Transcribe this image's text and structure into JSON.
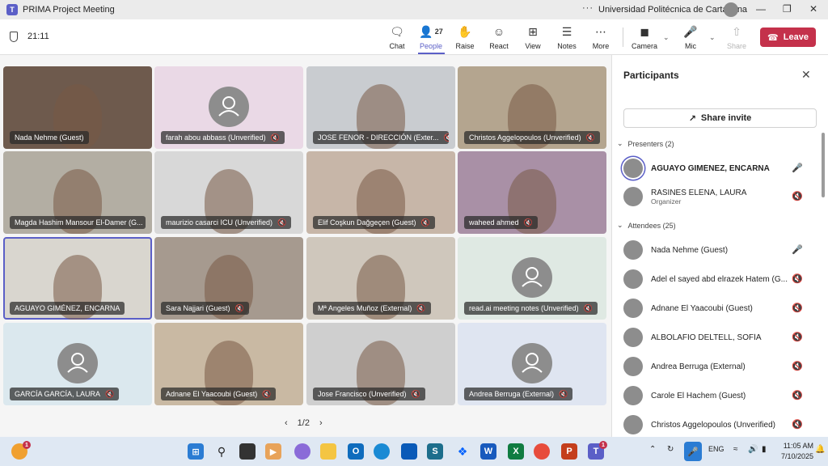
{
  "window": {
    "title": "PRIMA Project Meeting",
    "organization": "Universidad Politécnica de Cartagena",
    "more": "···"
  },
  "toolbar": {
    "timer": "21:11",
    "chat": "Chat",
    "people": "People",
    "people_count": "27",
    "raise": "Raise",
    "react": "React",
    "view": "View",
    "notes": "Notes",
    "more": "More",
    "camera": "Camera",
    "mic": "Mic",
    "share": "Share",
    "leave": "Leave"
  },
  "tiles": [
    {
      "name": "Nada Nehme (Guest)",
      "muted": false,
      "video": true,
      "bg": "#6e5a4d"
    },
    {
      "name": "farah abou abbass (Unverified)",
      "muted": true,
      "video": false,
      "bg": "#ead9e6"
    },
    {
      "name": "JOSE FENOR - DIRECCIÓN (Exter...",
      "muted": true,
      "video": true,
      "bg": "#c9ccd0"
    },
    {
      "name": "Christos Aggelopoulos (Unverified)",
      "muted": true,
      "video": true,
      "bg": "#b4a58f"
    },
    {
      "name": "Magda Hashim Mansour El-Damer (G...",
      "muted": false,
      "video": true,
      "bg": "#b3aea3"
    },
    {
      "name": "maurizio casarci ICU (Unverified)",
      "muted": true,
      "video": true,
      "bg": "#d8d8d8"
    },
    {
      "name": "Elif Coşkun Dağgeçen (Guest)",
      "muted": true,
      "video": true,
      "bg": "#c7b6a8"
    },
    {
      "name": "waheed ahmed",
      "muted": true,
      "video": true,
      "bg": "#a990a6"
    },
    {
      "name": "AGUAYO GIMÉNEZ, ENCARNA",
      "muted": false,
      "video": true,
      "bg": "#d9d6cf"
    },
    {
      "name": "Sara Najjari (Guest)",
      "muted": true,
      "video": true,
      "bg": "#a69a8f"
    },
    {
      "name": "Mª Angeles Muñoz (External)",
      "muted": true,
      "video": true,
      "bg": "#cfc7bc"
    },
    {
      "name": "read.ai meeting notes (Unverified)",
      "muted": true,
      "video": false,
      "bg": "#dfe9e3"
    },
    {
      "name": "GARCÍA GARCÍA, LAURA",
      "muted": true,
      "video": false,
      "bg": "#dbe8ee"
    },
    {
      "name": "Adnane El Yaacoubi (Guest)",
      "muted": true,
      "video": true,
      "bg": "#c9b9a3"
    },
    {
      "name": "Jose Francisco (Unverified)",
      "muted": true,
      "video": true,
      "bg": "#cfcfcf"
    },
    {
      "name": "Andrea Berruga (External)",
      "muted": true,
      "video": false,
      "bg": "#dfe5f1"
    }
  ],
  "pager": {
    "label": "1/2"
  },
  "panel": {
    "title": "Participants",
    "share_invite": "Share invite",
    "presenters_label": "Presenters (2)",
    "attendees_label": "Attendees (25)",
    "presenters": [
      {
        "name": "AGUAYO GIMÉNEZ, ENCARNA",
        "sub": "",
        "muted": false
      },
      {
        "name": "RASINES ELENA, LAURA",
        "sub": "Organizer",
        "muted": true
      }
    ],
    "attendees": [
      {
        "name": "Nada Nehme (Guest)",
        "muted": false
      },
      {
        "name": "Adel el sayed abd elrazek Hatem (G...",
        "muted": true
      },
      {
        "name": "Adnane El Yaacoubi (Guest)",
        "muted": true
      },
      {
        "name": "ALBOLAFIO DELTELL, SOFÍA",
        "muted": true
      },
      {
        "name": "Andrea Berruga (External)",
        "muted": true
      },
      {
        "name": "Carole El Hachem (Guest)",
        "muted": true
      },
      {
        "name": "Christos Aggelopoulos (Unverified)",
        "muted": true
      }
    ]
  },
  "taskbar": {
    "lang": "ENG",
    "time": "11:05 AM",
    "date": "7/10/2025",
    "weather_badge": "1",
    "teams_badge": "1"
  }
}
